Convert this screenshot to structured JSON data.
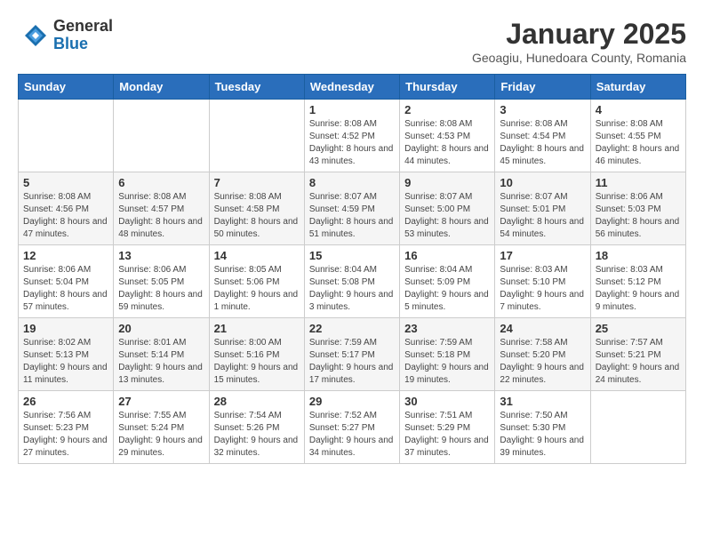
{
  "logo": {
    "general": "General",
    "blue": "Blue"
  },
  "title": "January 2025",
  "location": "Geoagiu, Hunedoara County, Romania",
  "days_of_week": [
    "Sunday",
    "Monday",
    "Tuesday",
    "Wednesday",
    "Thursday",
    "Friday",
    "Saturday"
  ],
  "weeks": [
    [
      {
        "day": "",
        "info": ""
      },
      {
        "day": "",
        "info": ""
      },
      {
        "day": "",
        "info": ""
      },
      {
        "day": "1",
        "info": "Sunrise: 8:08 AM\nSunset: 4:52 PM\nDaylight: 8 hours and 43 minutes."
      },
      {
        "day": "2",
        "info": "Sunrise: 8:08 AM\nSunset: 4:53 PM\nDaylight: 8 hours and 44 minutes."
      },
      {
        "day": "3",
        "info": "Sunrise: 8:08 AM\nSunset: 4:54 PM\nDaylight: 8 hours and 45 minutes."
      },
      {
        "day": "4",
        "info": "Sunrise: 8:08 AM\nSunset: 4:55 PM\nDaylight: 8 hours and 46 minutes."
      }
    ],
    [
      {
        "day": "5",
        "info": "Sunrise: 8:08 AM\nSunset: 4:56 PM\nDaylight: 8 hours and 47 minutes."
      },
      {
        "day": "6",
        "info": "Sunrise: 8:08 AM\nSunset: 4:57 PM\nDaylight: 8 hours and 48 minutes."
      },
      {
        "day": "7",
        "info": "Sunrise: 8:08 AM\nSunset: 4:58 PM\nDaylight: 8 hours and 50 minutes."
      },
      {
        "day": "8",
        "info": "Sunrise: 8:07 AM\nSunset: 4:59 PM\nDaylight: 8 hours and 51 minutes."
      },
      {
        "day": "9",
        "info": "Sunrise: 8:07 AM\nSunset: 5:00 PM\nDaylight: 8 hours and 53 minutes."
      },
      {
        "day": "10",
        "info": "Sunrise: 8:07 AM\nSunset: 5:01 PM\nDaylight: 8 hours and 54 minutes."
      },
      {
        "day": "11",
        "info": "Sunrise: 8:06 AM\nSunset: 5:03 PM\nDaylight: 8 hours and 56 minutes."
      }
    ],
    [
      {
        "day": "12",
        "info": "Sunrise: 8:06 AM\nSunset: 5:04 PM\nDaylight: 8 hours and 57 minutes."
      },
      {
        "day": "13",
        "info": "Sunrise: 8:06 AM\nSunset: 5:05 PM\nDaylight: 8 hours and 59 minutes."
      },
      {
        "day": "14",
        "info": "Sunrise: 8:05 AM\nSunset: 5:06 PM\nDaylight: 9 hours and 1 minute."
      },
      {
        "day": "15",
        "info": "Sunrise: 8:04 AM\nSunset: 5:08 PM\nDaylight: 9 hours and 3 minutes."
      },
      {
        "day": "16",
        "info": "Sunrise: 8:04 AM\nSunset: 5:09 PM\nDaylight: 9 hours and 5 minutes."
      },
      {
        "day": "17",
        "info": "Sunrise: 8:03 AM\nSunset: 5:10 PM\nDaylight: 9 hours and 7 minutes."
      },
      {
        "day": "18",
        "info": "Sunrise: 8:03 AM\nSunset: 5:12 PM\nDaylight: 9 hours and 9 minutes."
      }
    ],
    [
      {
        "day": "19",
        "info": "Sunrise: 8:02 AM\nSunset: 5:13 PM\nDaylight: 9 hours and 11 minutes."
      },
      {
        "day": "20",
        "info": "Sunrise: 8:01 AM\nSunset: 5:14 PM\nDaylight: 9 hours and 13 minutes."
      },
      {
        "day": "21",
        "info": "Sunrise: 8:00 AM\nSunset: 5:16 PM\nDaylight: 9 hours and 15 minutes."
      },
      {
        "day": "22",
        "info": "Sunrise: 7:59 AM\nSunset: 5:17 PM\nDaylight: 9 hours and 17 minutes."
      },
      {
        "day": "23",
        "info": "Sunrise: 7:59 AM\nSunset: 5:18 PM\nDaylight: 9 hours and 19 minutes."
      },
      {
        "day": "24",
        "info": "Sunrise: 7:58 AM\nSunset: 5:20 PM\nDaylight: 9 hours and 22 minutes."
      },
      {
        "day": "25",
        "info": "Sunrise: 7:57 AM\nSunset: 5:21 PM\nDaylight: 9 hours and 24 minutes."
      }
    ],
    [
      {
        "day": "26",
        "info": "Sunrise: 7:56 AM\nSunset: 5:23 PM\nDaylight: 9 hours and 27 minutes."
      },
      {
        "day": "27",
        "info": "Sunrise: 7:55 AM\nSunset: 5:24 PM\nDaylight: 9 hours and 29 minutes."
      },
      {
        "day": "28",
        "info": "Sunrise: 7:54 AM\nSunset: 5:26 PM\nDaylight: 9 hours and 32 minutes."
      },
      {
        "day": "29",
        "info": "Sunrise: 7:52 AM\nSunset: 5:27 PM\nDaylight: 9 hours and 34 minutes."
      },
      {
        "day": "30",
        "info": "Sunrise: 7:51 AM\nSunset: 5:29 PM\nDaylight: 9 hours and 37 minutes."
      },
      {
        "day": "31",
        "info": "Sunrise: 7:50 AM\nSunset: 5:30 PM\nDaylight: 9 hours and 39 minutes."
      },
      {
        "day": "",
        "info": ""
      }
    ]
  ]
}
